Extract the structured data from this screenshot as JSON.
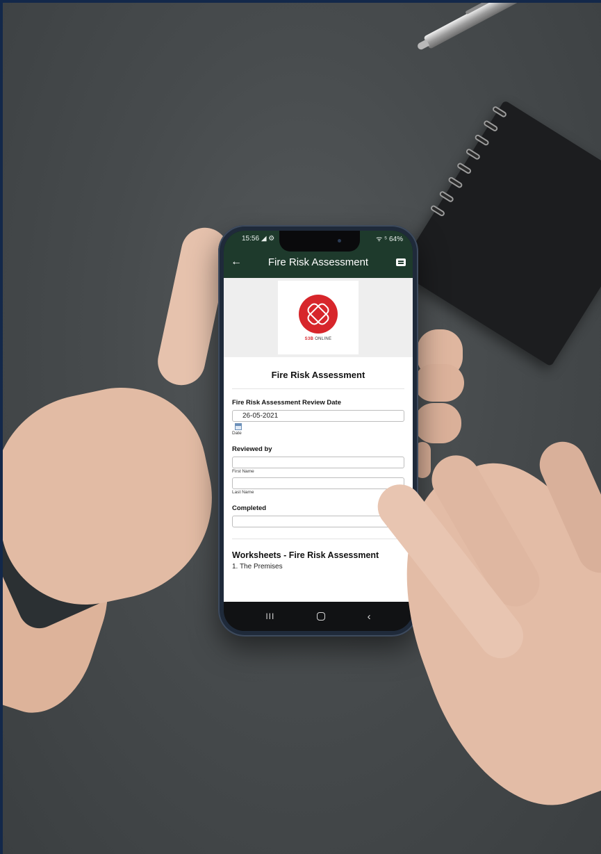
{
  "status": {
    "time": "15:56",
    "left_icons": "◢ ⚙",
    "right_icons": "ᯤ ⁵",
    "battery": "64%"
  },
  "appbar": {
    "title": "Fire Risk Assessment",
    "back_icon": "arrow-left-icon",
    "chat_icon": "chat-icon"
  },
  "logo": {
    "brand_bold": "S3B",
    "brand_rest": " ONLINE"
  },
  "form": {
    "title": "Fire Risk Assessment",
    "review_date_label": "Fire Risk Assessment Review Date",
    "review_date_value": "26-05-2021",
    "date_hint": "Date",
    "reviewed_by_label": "Reviewed by",
    "first_name_value": "",
    "first_name_hint": "First Name",
    "last_name_value": "",
    "last_name_hint": "Last Name",
    "completed_label": "Completed",
    "completed_value": ""
  },
  "worksheets": {
    "title": "Worksheets - Fire Risk Assessment",
    "items": [
      "1. The Premises"
    ]
  },
  "navbar": {
    "recent": "III",
    "back": "‹"
  },
  "colors": {
    "appbar": "#1e3a2c",
    "logo_red": "#d7262b",
    "frame": "#13284a"
  }
}
